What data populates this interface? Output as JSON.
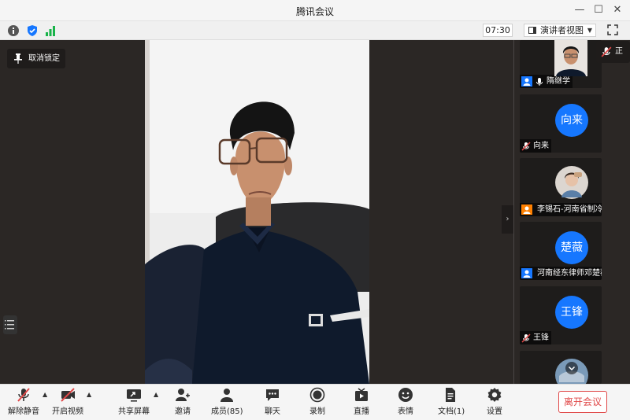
{
  "app": {
    "title": "腾讯会议"
  },
  "window_controls": {
    "minimize": "—",
    "maximize": "☐",
    "close": "✕"
  },
  "top_toolbar": {
    "timer": "07:30",
    "view_mode": "演讲者视图",
    "icons": [
      "info-icon",
      "shield-icon",
      "signal-icon",
      "fullscreen-icon"
    ]
  },
  "main": {
    "unlock_label": "取消锁定",
    "collapse_arrow": "›"
  },
  "mini_self": {
    "muted_label": "正"
  },
  "participants": [
    {
      "name": "隋继学",
      "avatar_text": "",
      "type": "video",
      "badge": "blue",
      "mic": "on"
    },
    {
      "name": "向来",
      "avatar_text": "向来",
      "type": "avatar",
      "badge": "",
      "mic": "muted"
    },
    {
      "name": "李锡石-河南省制冷...",
      "avatar_text": "",
      "type": "photo",
      "badge": "orange",
      "mic": "muted"
    },
    {
      "name": "河南经东律师邓楚薇",
      "avatar_text": "楚薇",
      "type": "avatar",
      "badge": "blue",
      "mic": "muted"
    },
    {
      "name": "王锋",
      "avatar_text": "王锋",
      "type": "avatar",
      "badge": "",
      "mic": "muted"
    }
  ],
  "bottom_toolbar": {
    "unmute": "解除静音",
    "start_video": "开启视频",
    "share_screen": "共享屏幕",
    "invite": "邀请",
    "members": "成员(85)",
    "chat": "聊天",
    "record": "录制",
    "live": "直播",
    "reactions": "表情",
    "documents": "文档(1)",
    "settings": "设置",
    "leave": "离开会议"
  },
  "colors": {
    "accent": "#1677ff",
    "leave": "#e04848",
    "mute_red": "#e04848",
    "badge_orange": "#ff8000"
  }
}
